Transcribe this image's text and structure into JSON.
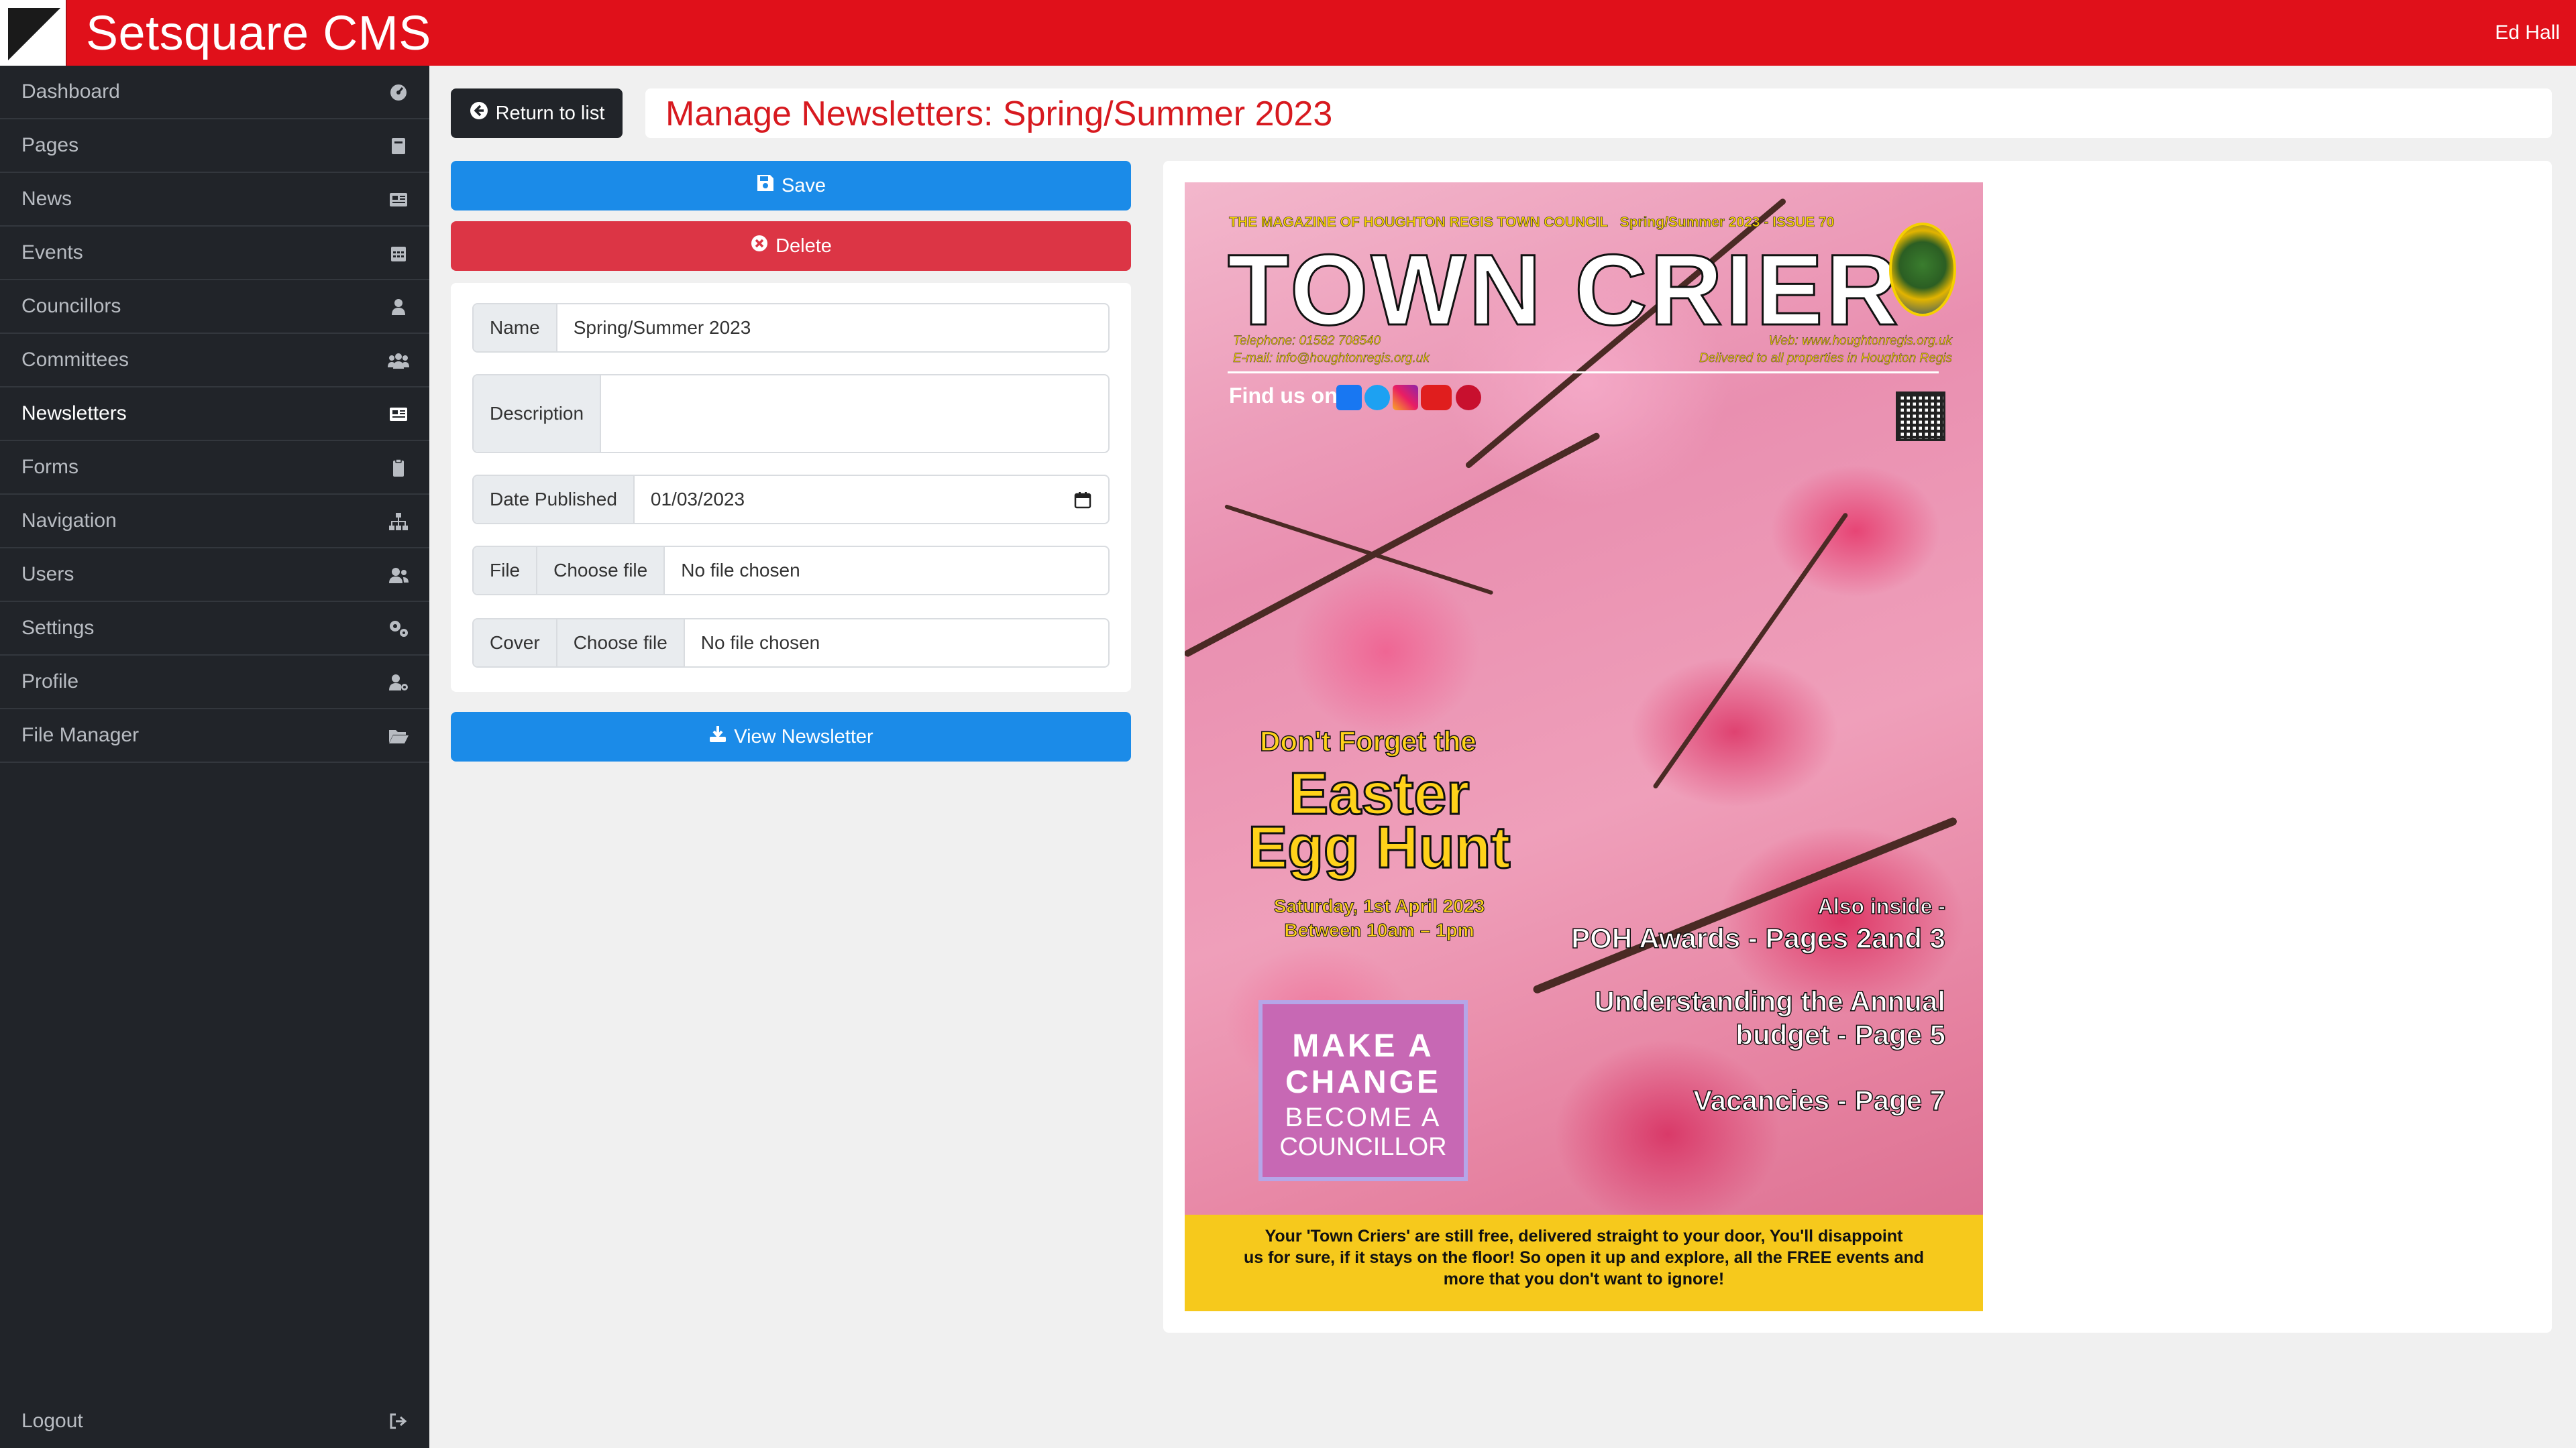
{
  "app": {
    "title": "Setsquare CMS",
    "user": "Ed Hall"
  },
  "sidebar": {
    "items": [
      {
        "label": "Dashboard",
        "icon": "dashboard-icon"
      },
      {
        "label": "Pages",
        "icon": "book-icon"
      },
      {
        "label": "News",
        "icon": "newspaper-icon"
      },
      {
        "label": "Events",
        "icon": "calendar-icon"
      },
      {
        "label": "Councillors",
        "icon": "user-icon"
      },
      {
        "label": "Committees",
        "icon": "users-icon"
      },
      {
        "label": "Newsletters",
        "icon": "newsletter-icon",
        "active": true
      },
      {
        "label": "Forms",
        "icon": "clipboard-icon"
      },
      {
        "label": "Navigation",
        "icon": "sitemap-icon"
      },
      {
        "label": "Users",
        "icon": "user-group-icon"
      },
      {
        "label": "Settings",
        "icon": "gears-icon"
      },
      {
        "label": "Profile",
        "icon": "user-gear-icon"
      },
      {
        "label": "File Manager",
        "icon": "folder-open-icon"
      }
    ],
    "logout": "Logout"
  },
  "header": {
    "return_label": "Return to list",
    "page_title": "Manage Newsletters: Spring/Summer 2023"
  },
  "actions": {
    "save_label": "Save",
    "delete_label": "Delete",
    "view_label": "View Newsletter"
  },
  "form": {
    "name_label": "Name",
    "name_value": "Spring/Summer 2023",
    "description_label": "Description",
    "description_value": "",
    "date_label": "Date Published",
    "date_value": "01/03/2023",
    "file_label": "File",
    "file_choose": "Choose file",
    "file_status": "No file chosen",
    "cover_label": "Cover",
    "cover_choose": "Choose file",
    "cover_status": "No file chosen"
  },
  "cover": {
    "magazine_line": "THE MAGAZINE OF HOUGHTON REGIS TOWN COUNCIL",
    "issue_line": "Spring/Summer 2023 - ISSUE 70",
    "masthead": "TOWN CRIER",
    "telephone": "Telephone: 01582 708540",
    "email": "E-mail: info@houghtonregis.org.uk",
    "web": "Web: www.houghtonregis.org.uk",
    "delivered": "Delivered to all properties in Houghton Regis",
    "find_us": "Find us on",
    "egg_line1": "Don't Forget the",
    "egg_line2": "Easter Egg Hunt",
    "egg_line3": "Saturday, 1st April 2023",
    "egg_line4": "Between 10am – 1pm",
    "mc_line1": "MAKE A CHANGE",
    "mc_line2": "BECOME A",
    "mc_line3": "COUNCILLOR",
    "inside_1": "Also inside -",
    "inside_2": "POH Awards - Pages 2and 3",
    "inside_3": "Understanding the Annual",
    "inside_4": "budget - Page 5",
    "inside_5": "Vacancies - Page 7",
    "banner_1": "Your 'Town Criers' are still free, delivered straight to your door,  You'll disappoint",
    "banner_2": "us for sure, if it stays on the floor! So open it up and explore, all the FREE events and",
    "banner_3": "more that you don't want to ignore!"
  },
  "colors": {
    "brand": "#e0101a",
    "primary": "#1b8be8",
    "danger": "#dc3545",
    "sidebar": "#212429"
  }
}
